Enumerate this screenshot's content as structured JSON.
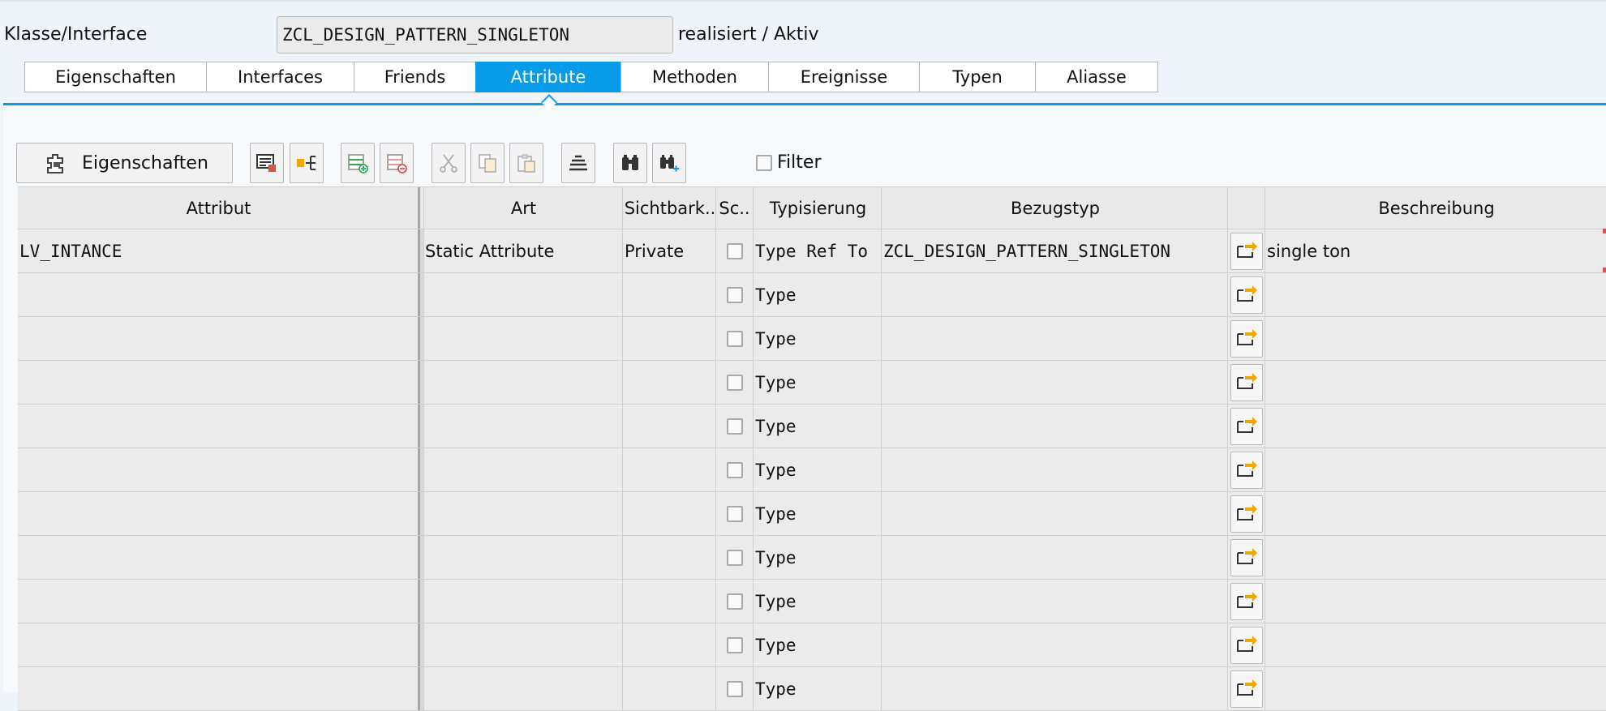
{
  "header": {
    "label": "Klasse/Interface",
    "class_name": "ZCL_DESIGN_PATTERN_SINGLETON",
    "status": "realisiert / Aktiv"
  },
  "tabs": [
    {
      "label": "Eigenschaften"
    },
    {
      "label": "Interfaces"
    },
    {
      "label": "Friends"
    },
    {
      "label": "Attribute",
      "active": true
    },
    {
      "label": "Methoden"
    },
    {
      "label": "Ereignisse"
    },
    {
      "label": "Typen"
    },
    {
      "label": "Aliasse"
    }
  ],
  "toolbar": {
    "properties_label": "Eigenschaften",
    "filter_label": "Filter",
    "icons": [
      "detail-view-icon",
      "navigate-icon",
      "insert-row-icon",
      "delete-row-icon",
      "cut-icon",
      "copy-icon",
      "paste-icon",
      "align-icon",
      "find-icon",
      "find-next-icon"
    ]
  },
  "table": {
    "columns": [
      "Attribut",
      "Art",
      "Sichtbark..",
      "Sc..",
      "Typisierung",
      "Bezugstyp",
      "",
      "Beschreibung"
    ],
    "rows": [
      {
        "attribut": "LV_INTANCE",
        "art": "Static Attribute",
        "sichtbarkeit": "Private",
        "typisierung": "Type Ref To",
        "bezugstyp": "ZCL_DESIGN_PATTERN_SINGLETON",
        "beschreibung": "single ton"
      },
      {
        "attribut": "",
        "art": "",
        "sichtbarkeit": "",
        "typisierung": "Type",
        "bezugstyp": "",
        "beschreibung": ""
      },
      {
        "attribut": "",
        "art": "",
        "sichtbarkeit": "",
        "typisierung": "Type",
        "bezugstyp": "",
        "beschreibung": ""
      },
      {
        "attribut": "",
        "art": "",
        "sichtbarkeit": "",
        "typisierung": "Type",
        "bezugstyp": "",
        "beschreibung": ""
      },
      {
        "attribut": "",
        "art": "",
        "sichtbarkeit": "",
        "typisierung": "Type",
        "bezugstyp": "",
        "beschreibung": ""
      },
      {
        "attribut": "",
        "art": "",
        "sichtbarkeit": "",
        "typisierung": "Type",
        "bezugstyp": "",
        "beschreibung": ""
      },
      {
        "attribut": "",
        "art": "",
        "sichtbarkeit": "",
        "typisierung": "Type",
        "bezugstyp": "",
        "beschreibung": ""
      },
      {
        "attribut": "",
        "art": "",
        "sichtbarkeit": "",
        "typisierung": "Type",
        "bezugstyp": "",
        "beschreibung": ""
      },
      {
        "attribut": "",
        "art": "",
        "sichtbarkeit": "",
        "typisierung": "Type",
        "bezugstyp": "",
        "beschreibung": ""
      },
      {
        "attribut": "",
        "art": "",
        "sichtbarkeit": "",
        "typisierung": "Type",
        "bezugstyp": "",
        "beschreibung": ""
      },
      {
        "attribut": "",
        "art": "",
        "sichtbarkeit": "",
        "typisierung": "Type",
        "bezugstyp": "",
        "beschreibung": ""
      }
    ]
  },
  "colors": {
    "accent": "#0a9be8",
    "icon_orange": "#f0a800",
    "icon_green": "#3aa655",
    "icon_red": "#d9534f"
  }
}
